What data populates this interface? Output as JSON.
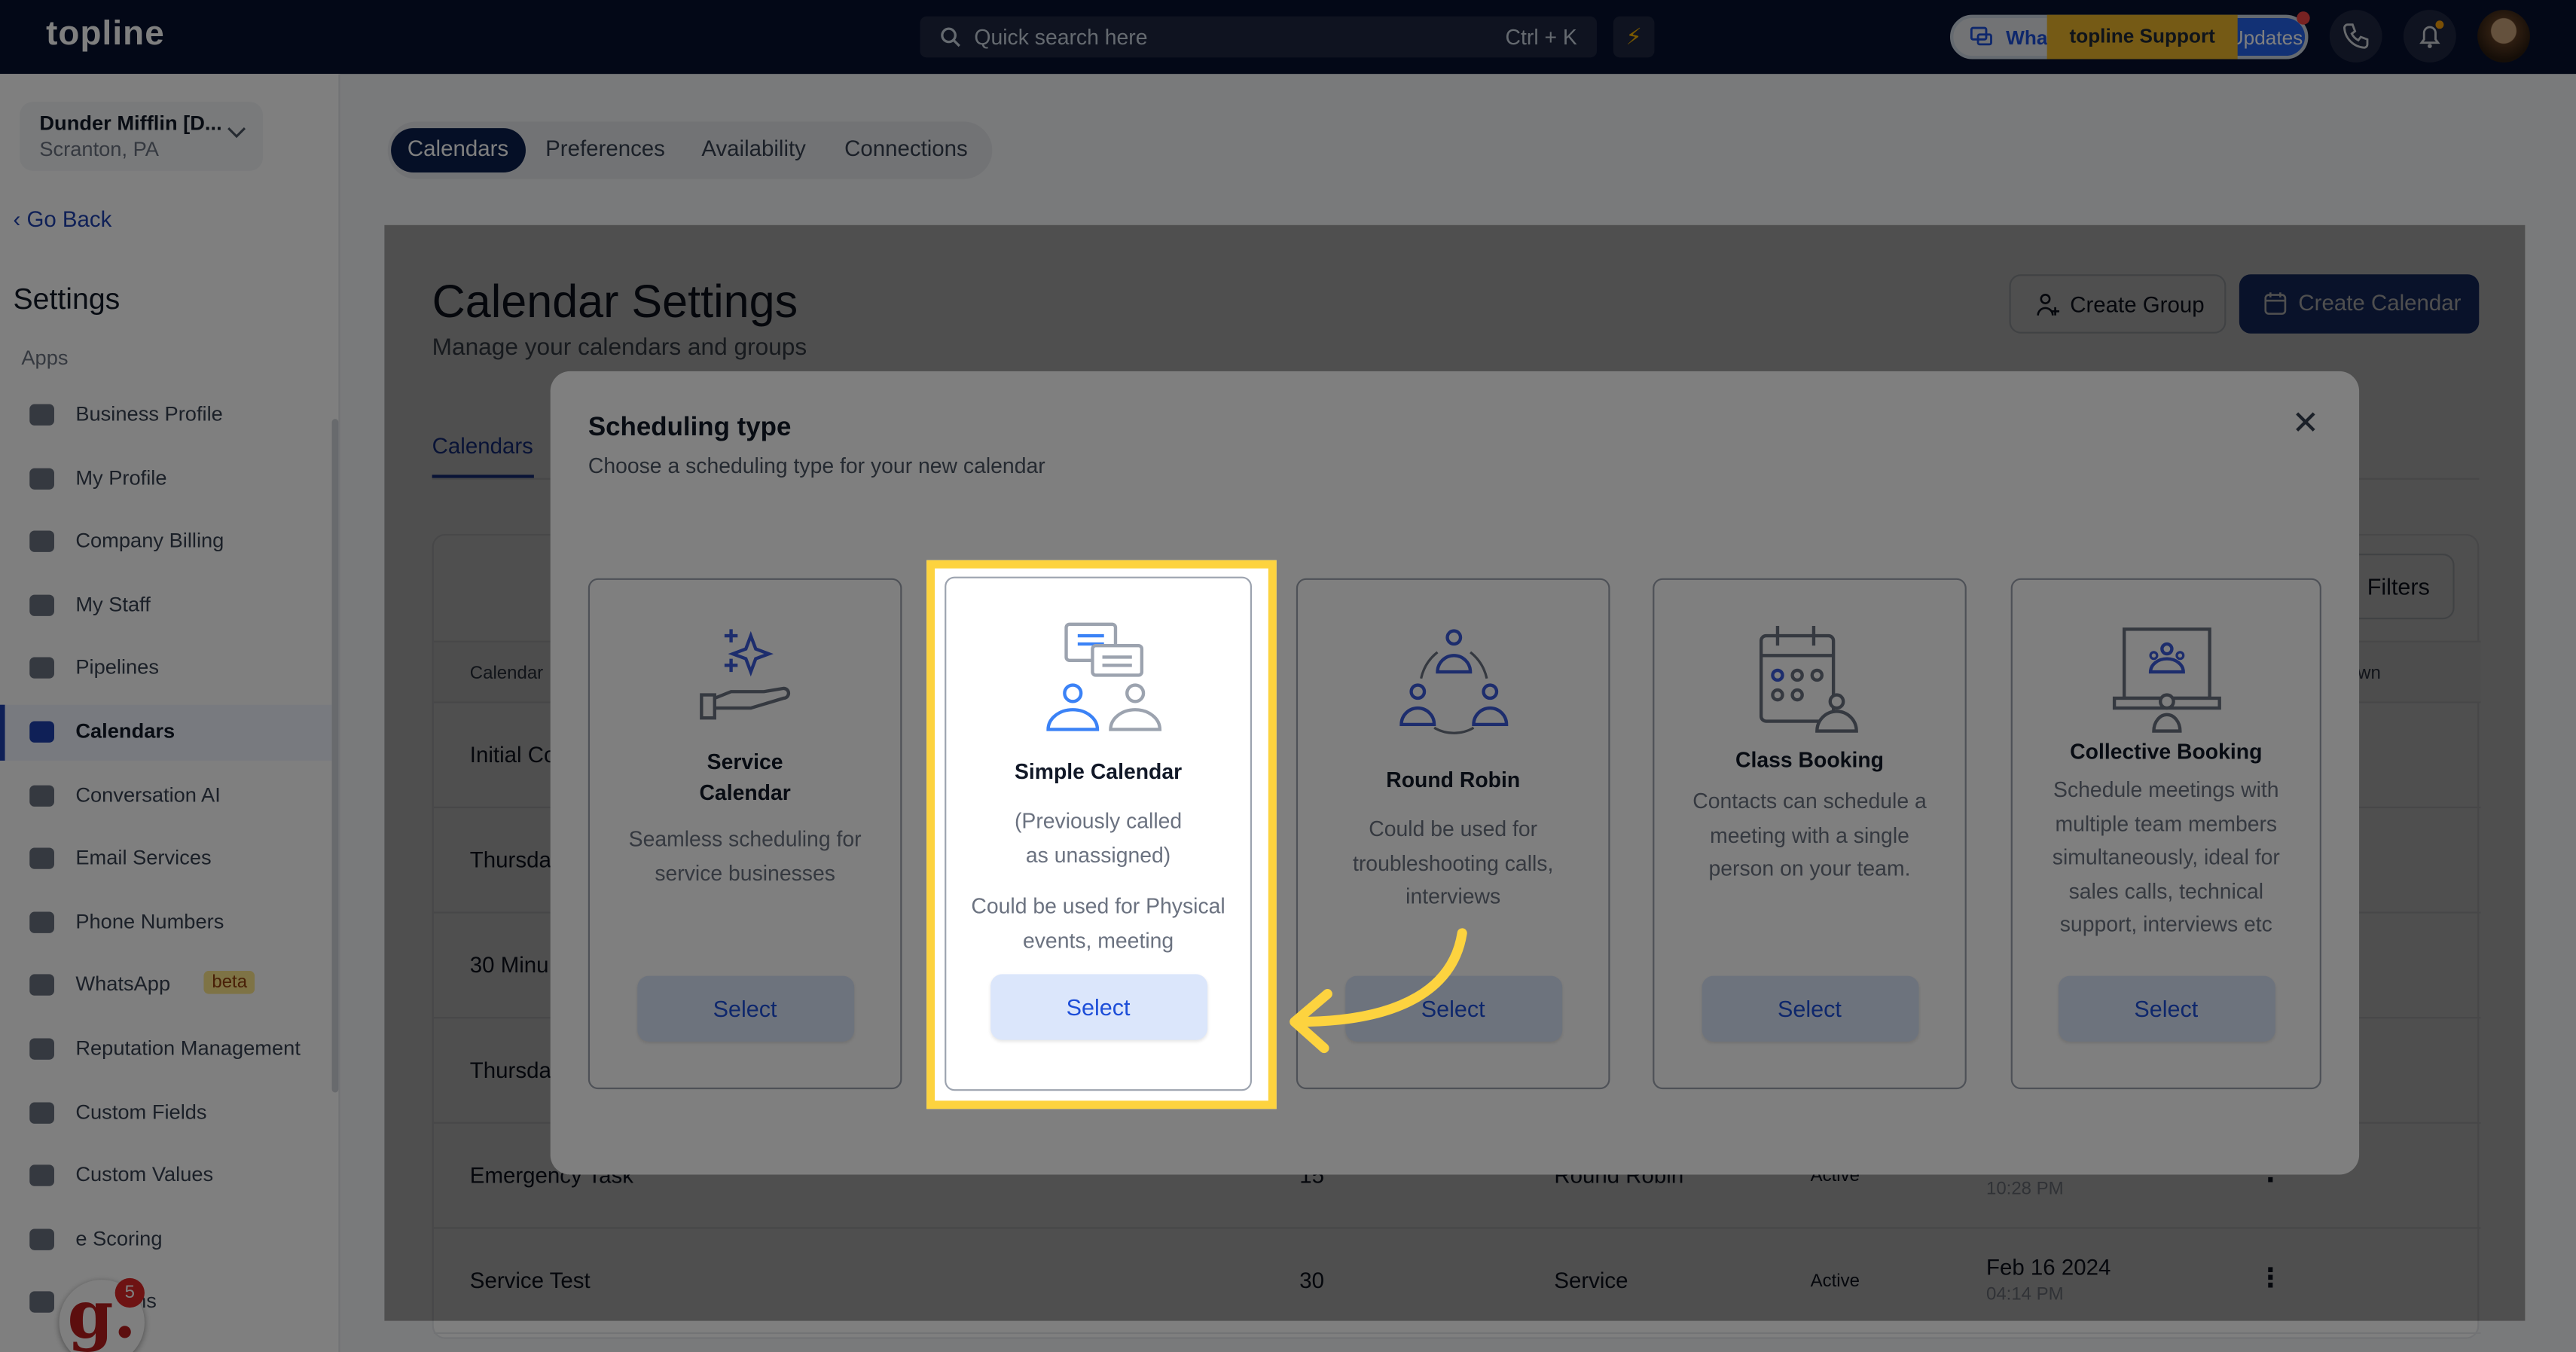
{
  "topbar": {
    "logo": "topline",
    "search_placeholder": "Quick search here",
    "search_shortcut": "Ctrl + K",
    "whats_new_label": "What's New",
    "updates_label": "Updates",
    "support_tag": "topline Support"
  },
  "sidebar": {
    "org_name": "Dunder Mifflin [D...",
    "org_location": "Scranton, PA",
    "go_back": "Go Back",
    "heading": "Settings",
    "section": "Apps",
    "items": [
      {
        "label": "Business Profile"
      },
      {
        "label": "My Profile"
      },
      {
        "label": "Company Billing"
      },
      {
        "label": "My Staff"
      },
      {
        "label": "Pipelines"
      },
      {
        "label": "Calendars",
        "active": true
      },
      {
        "label": "Conversation AI"
      },
      {
        "label": "Email Services"
      },
      {
        "label": "Phone Numbers"
      },
      {
        "label": "WhatsApp",
        "badge": "beta"
      },
      {
        "label": "Reputation Management"
      },
      {
        "label": "Custom Fields"
      },
      {
        "label": "Custom Values"
      },
      {
        "label": "e Scoring"
      },
      {
        "label": "Domains"
      }
    ],
    "widget_letter": "g.",
    "widget_count": "5"
  },
  "tabs": [
    "Calendars",
    "Preferences",
    "Availability",
    "Connections"
  ],
  "page": {
    "title": "Calendar Settings",
    "subtitle": "Manage your calendars and groups",
    "create_group": "Create Group",
    "create_calendar": "Create Calendar",
    "subtab": "Calendars",
    "filters": "Filters",
    "table": {
      "headers": [
        "Calendar",
        "own"
      ],
      "rows": [
        {
          "name": "Initial Co"
        },
        {
          "name": "Thursda"
        },
        {
          "name": "30 Minu"
        },
        {
          "name": "Thursda"
        },
        {
          "name": "Emergency Task",
          "duration": "15",
          "type": "Round Robin",
          "status": "Active",
          "date": "",
          "time": "10:28 PM"
        },
        {
          "name": "Service Test",
          "duration": "30",
          "type": "Service",
          "status": "Active",
          "date": "Feb 16 2024",
          "time": "04:14 PM"
        }
      ]
    }
  },
  "modal": {
    "title": "Scheduling type",
    "subtitle": "Choose a scheduling type for your new calendar",
    "select_label": "Select",
    "cards": [
      {
        "name": "Service Calendar",
        "desc": "Seamless scheduling for service businesses",
        "icon": "sparkle-hand-icon"
      },
      {
        "name": "Simple Calendar",
        "note": "(Previously called as unassigned)",
        "desc": "Could be used for Physical events, meeting",
        "icon": "chat-people-icon",
        "highlighted": true
      },
      {
        "name": "Round Robin",
        "desc": "Could be used for troubleshooting calls, interviews",
        "icon": "round-robin-icon"
      },
      {
        "name": "Class Booking",
        "desc": "Contacts can schedule a meeting with a single person on your team.",
        "icon": "class-calendar-icon"
      },
      {
        "name": "Collective Booking",
        "desc": "Schedule meetings with multiple team members simultaneously, ideal for sales calls, technical support, interviews etc",
        "icon": "presentation-group-icon"
      }
    ]
  },
  "colors": {
    "highlight": "#fdd33f",
    "primary": "#1e3a8a",
    "link": "#1d4ed8"
  }
}
